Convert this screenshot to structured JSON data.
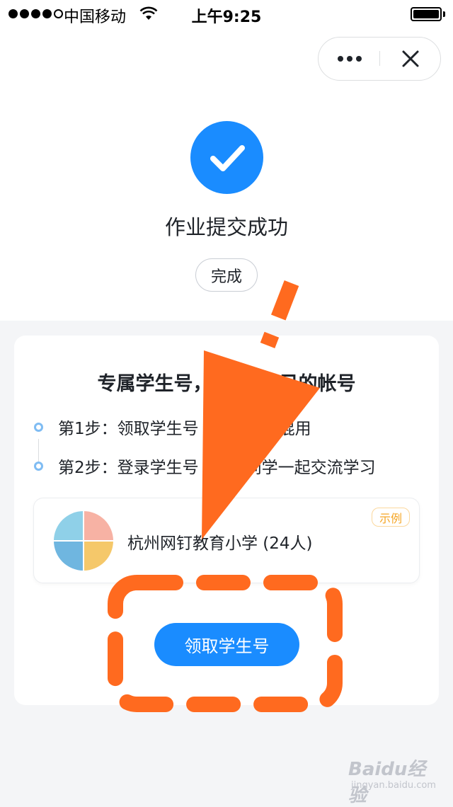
{
  "status_bar": {
    "carrier": "中国移动",
    "time": "上午9:25"
  },
  "success": {
    "title": "作业提交成功",
    "done_label": "完成",
    "accent_color": "#1a8cff"
  },
  "card": {
    "title": "专属学生号，",
    "title_tail": "己的帐号",
    "steps": [
      {
        "prefix": "第1步：领取学生号",
        "suffix": "码混用"
      },
      {
        "prefix": "第2步：登录学生号",
        "suffix": "同学一起交流学习"
      }
    ],
    "school": {
      "name": "杭州网钉教育小学 (24人)",
      "badge": "示例"
    },
    "claim_label": "领取学生号"
  },
  "watermark": {
    "brand": "Baidu经验",
    "url": "jingyan.baidu.com"
  },
  "annotation_color": "#ff6a1f"
}
